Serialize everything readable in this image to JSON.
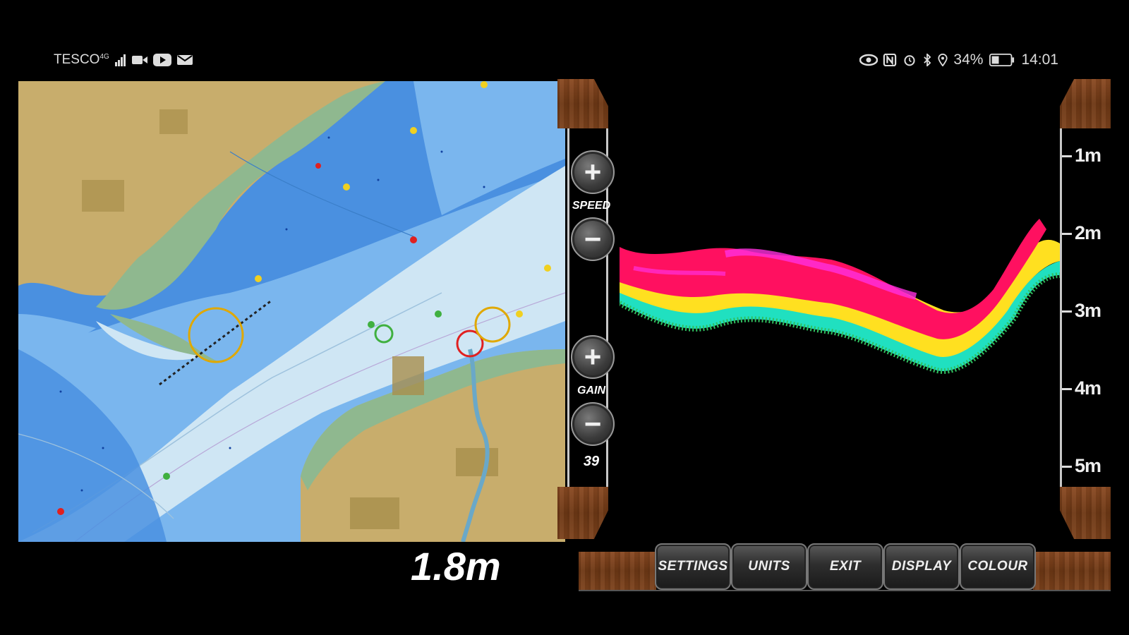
{
  "status_bar": {
    "carrier": "TESCO",
    "network_type": "4G",
    "battery_percent": "34%",
    "time": "14:01"
  },
  "controls": {
    "speed_label": "SPEED",
    "gain_label": "GAIN",
    "gain_value": "39",
    "plus_glyph": "+",
    "minus_glyph": "−"
  },
  "depth_scale": [
    "1m",
    "2m",
    "3m",
    "4m",
    "5m"
  ],
  "depth_reading": "1.8m",
  "menu": {
    "settings": "SETTINGS",
    "units": "UNITS",
    "exit": "EXIT",
    "display": "DISPLAY",
    "colour": "COLOUR"
  },
  "colors": {
    "land": "#c8ad6c",
    "marsh": "#8fb88f",
    "deep_water": "#4a90e0",
    "mid_water": "#7ab6ee",
    "shallow_water": "#cfe6f4",
    "sonar_strong": "#ff1060",
    "sonar_mid": "#ffe020",
    "sonar_weak": "#20e0c0"
  }
}
